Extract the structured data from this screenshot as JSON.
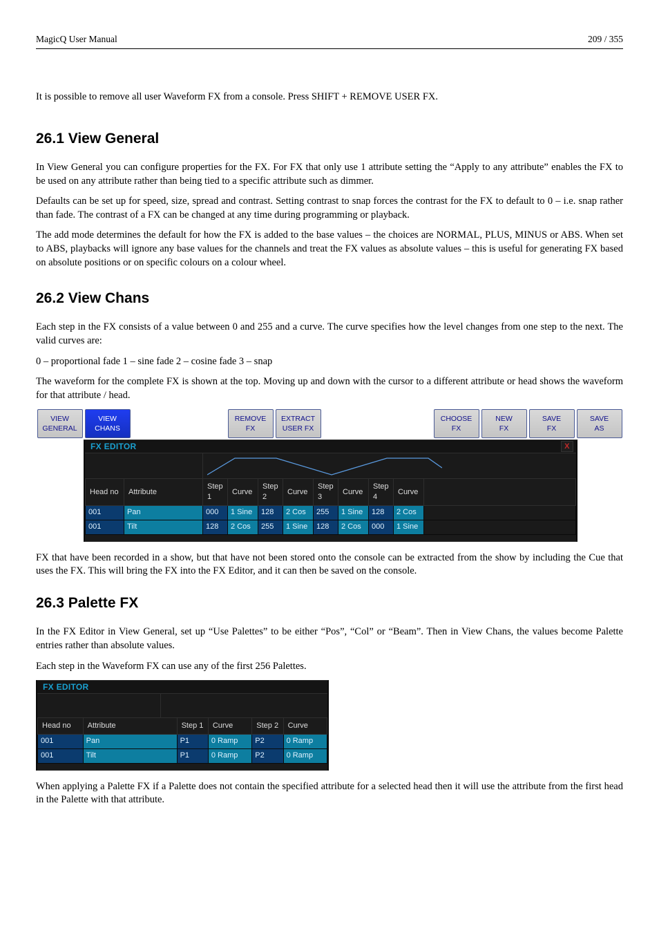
{
  "doc": {
    "header_left": "MagicQ User Manual",
    "header_right": "209 / 355",
    "intro_p": "It is possible to remove all user Waveform FX from a console. Press SHIFT + REMOVE USER FX.",
    "s1": {
      "heading": "26.1   View General",
      "p1": "In View General you can configure properties for the FX. For FX that only use 1 attribute setting the “Apply to any attribute” enables the FX to be used on any attribute rather than being tied to a specific attribute such as dimmer.",
      "p2": "Defaults can be set up for speed, size, spread and contrast. Setting contrast to snap forces the contrast for the FX to default to 0 – i.e. snap rather than fade. The contrast of a FX can be changed at any time during programming or playback.",
      "p3": "The add mode determines the default for how the FX is added to the base values – the choices are NORMAL, PLUS, MINUS or ABS. When set to ABS, playbacks will ignore any base values for the channels and treat the FX values as absolute values – this is useful for generating FX based on absolute positions or on specific colours on a colour wheel."
    },
    "s2": {
      "heading": "26.2   View Chans",
      "p1": "Each step in the FX consists of a value between 0 and 255 and a curve. The curve specifies how the level changes from one step to the next. The valid curves are:",
      "p2": "0 – proportional fade 1 – sine fade 2 – cosine fade 3 – snap",
      "p3": "The waveform for the complete FX is shown at the top. Moving up and down with the cursor to a different attribute or head shows the waveform for that attribute / head.",
      "after_p": "FX that have been recorded in a show, but that have not been stored onto the console can be extracted from the show by including the Cue that uses the FX. This will bring the FX into the FX Editor, and it can then be saved on the console."
    },
    "s3": {
      "heading": "26.3   Palette FX",
      "p1": "In the FX Editor in View General, set up “Use Palettes” to be either “Pos”, “Col” or “Beam”. Then in View Chans, the values become Palette entries rather than absolute values.",
      "p2": "Each step in the Waveform FX can use any of the first 256 Palettes.",
      "after_p": "When applying a Palette FX if a Palette does not contain the specified attribute for a selected head then it will use the attribute from the first head in the Palette with that attribute."
    }
  },
  "softbtns": {
    "b1_l1": "VIEW",
    "b1_l2": "GENERAL",
    "b2_l1": "VIEW",
    "b2_l2": "CHANS",
    "b5_l1": "REMOVE",
    "b5_l2": "FX",
    "b6_l1": "EXTRACT",
    "b6_l2": "USER FX",
    "b7_l1": "CHOOSE",
    "b7_l2": "FX",
    "b8_l1": "NEW",
    "b8_l2": "FX",
    "b9_l1": "SAVE",
    "b9_l2": "FX",
    "b10_l1": "SAVE",
    "b10_l2": "AS"
  },
  "panel1": {
    "title": "FX EDITOR",
    "close": "X",
    "headers": {
      "head_no": "Head no",
      "attribute": "Attribute",
      "step1": "Step 1",
      "curve1": "Curve",
      "step2": "Step 2",
      "curve2": "Curve",
      "step3": "Step 3",
      "curve3": "Curve",
      "step4": "Step 4",
      "curve4": "Curve"
    },
    "rows": [
      {
        "head": "001",
        "attr": "Pan",
        "s1": "000",
        "c1": "1 Sine",
        "s2": "128",
        "c2": "2 Cos",
        "s3": "255",
        "c3": "1 Sine",
        "s4": "128",
        "c4": "2 Cos"
      },
      {
        "head": "001",
        "attr": "Tilt",
        "s1": "128",
        "c1": "2 Cos",
        "s2": "255",
        "c2": "1 Sine",
        "s3": "128",
        "c3": "2 Cos",
        "s4": "000",
        "c4": "1 Sine"
      }
    ]
  },
  "panel2": {
    "title": "FX EDITOR",
    "headers": {
      "head_no": "Head no",
      "attribute": "Attribute",
      "step1": "Step 1",
      "curve1": "Curve",
      "step2": "Step 2",
      "curve2": "Curve"
    },
    "rows": [
      {
        "head": "001",
        "attr": "Pan",
        "s1": "P1",
        "c1": "0 Ramp",
        "s2": "P2",
        "c2": "0 Ramp"
      },
      {
        "head": "001",
        "attr": "Tilt",
        "s1": "P1",
        "c1": "0 Ramp",
        "s2": "P2",
        "c2": "0 Ramp"
      }
    ]
  }
}
